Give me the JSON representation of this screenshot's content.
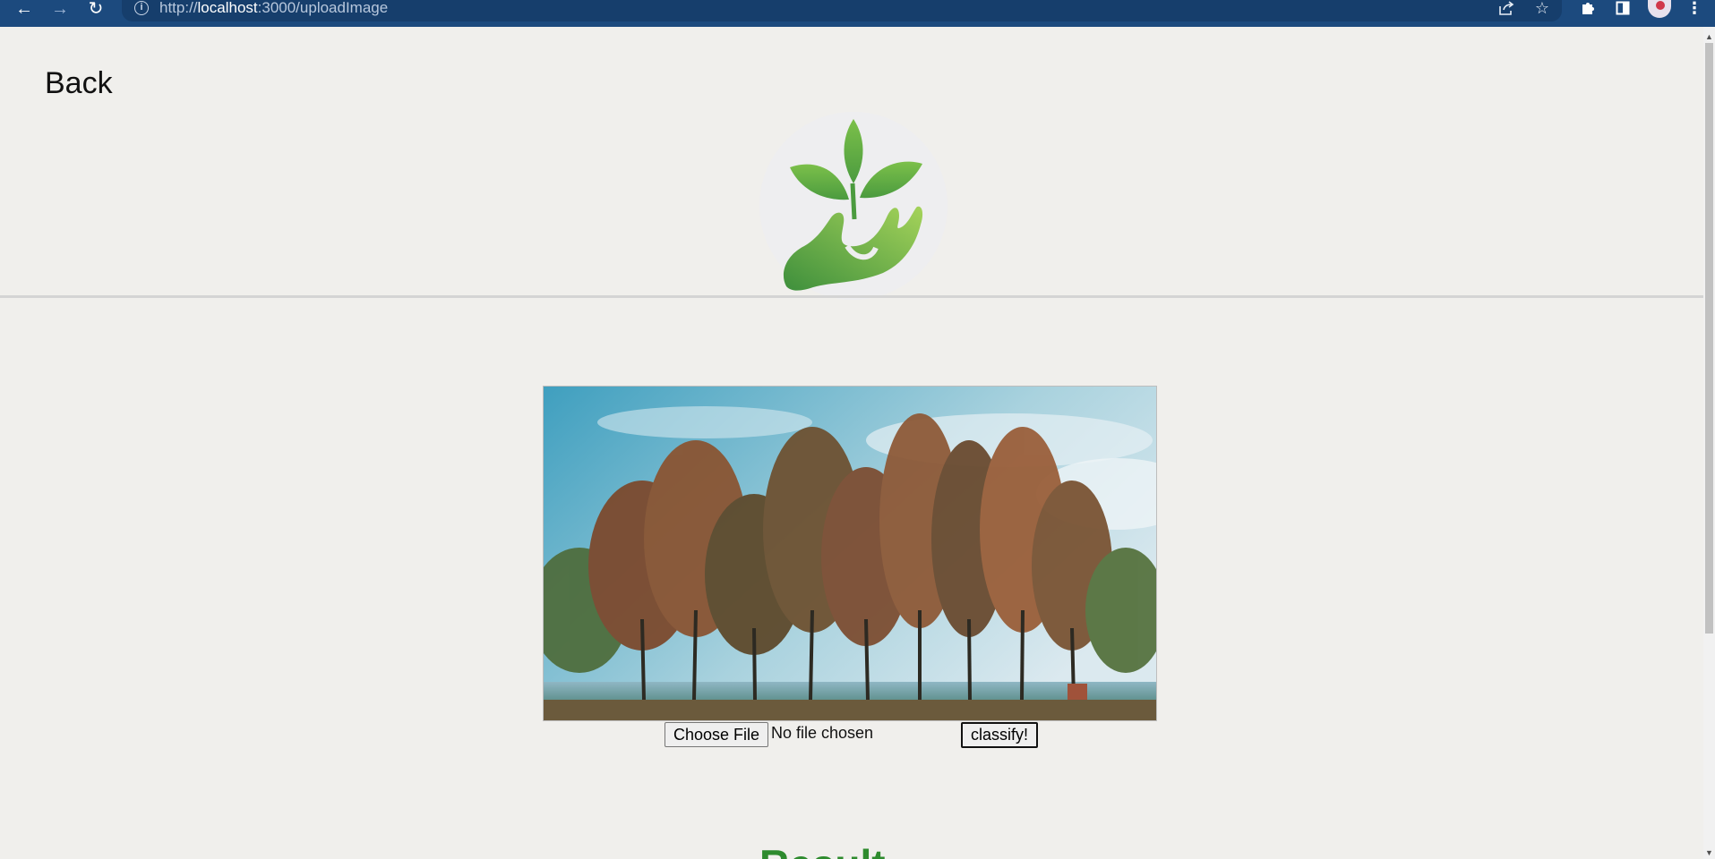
{
  "browser": {
    "url_scheme": "http://",
    "url_host": "localhost",
    "url_rest": ":3000/uploadImage",
    "icons": {
      "back": "arrow-left-icon",
      "forward": "arrow-right-icon",
      "reload": "reload-icon",
      "info": "info-icon",
      "share": "share-icon",
      "bookmark": "star-icon",
      "extensions": "puzzle-icon",
      "sidepanel": "side-panel-icon",
      "profile": "avatar",
      "menu": "kebab-menu-icon"
    },
    "chrome_color": "#1c4a7e"
  },
  "page": {
    "back_label": "Back",
    "logo": "plant-in-hand-logo",
    "hero_image": "autumn-trees-lake-photo",
    "upload": {
      "choose_label": "Choose File",
      "status": "No file chosen",
      "classify_label": "classify!"
    },
    "result_heading": "Result",
    "accent_green": "#2e8b2e"
  }
}
